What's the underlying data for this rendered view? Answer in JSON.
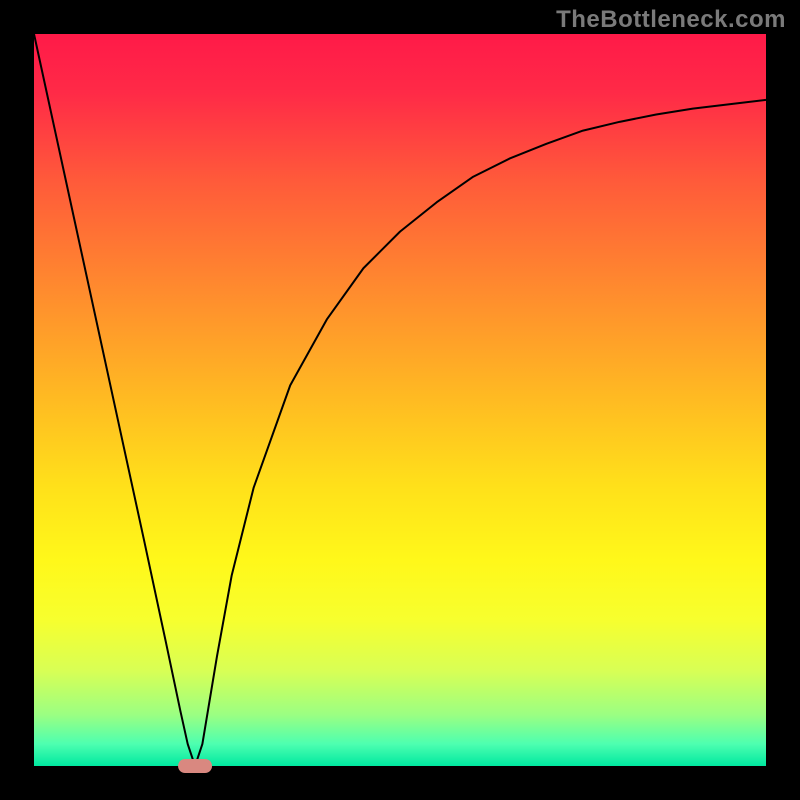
{
  "watermark": "TheBottleneck.com",
  "chart_data": {
    "type": "line",
    "title": "",
    "xlabel": "",
    "ylabel": "",
    "xlim": [
      0,
      100
    ],
    "ylim": [
      0,
      100
    ],
    "x": [
      0,
      5,
      10,
      15,
      18,
      20,
      21,
      22,
      23,
      25,
      27,
      30,
      35,
      40,
      45,
      50,
      55,
      60,
      65,
      70,
      75,
      80,
      85,
      90,
      95,
      100
    ],
    "values": [
      100,
      77,
      54,
      31,
      17,
      7.5,
      3,
      0,
      3,
      15,
      26,
      38,
      52,
      61,
      68,
      73,
      77,
      80.5,
      83,
      85,
      86.8,
      88,
      89,
      89.8,
      90.4,
      91
    ],
    "minimum_x": 22,
    "minimum_y": 0,
    "marker": {
      "x": 22,
      "y": 0,
      "color": "#d98880"
    },
    "background": {
      "type": "vertical-gradient",
      "stops": [
        {
          "offset": 0.0,
          "color": "#ff1a48"
        },
        {
          "offset": 0.08,
          "color": "#ff2a47"
        },
        {
          "offset": 0.2,
          "color": "#ff5a3a"
        },
        {
          "offset": 0.35,
          "color": "#ff8b2e"
        },
        {
          "offset": 0.5,
          "color": "#ffbb22"
        },
        {
          "offset": 0.62,
          "color": "#ffe11a"
        },
        {
          "offset": 0.72,
          "color": "#fff81a"
        },
        {
          "offset": 0.8,
          "color": "#f7ff2e"
        },
        {
          "offset": 0.87,
          "color": "#d8ff55"
        },
        {
          "offset": 0.93,
          "color": "#9bff82"
        },
        {
          "offset": 0.97,
          "color": "#4dffb0"
        },
        {
          "offset": 1.0,
          "color": "#00e8a0"
        }
      ]
    },
    "frame_color": "#000000",
    "line_color": "#000000",
    "line_width": 2
  }
}
